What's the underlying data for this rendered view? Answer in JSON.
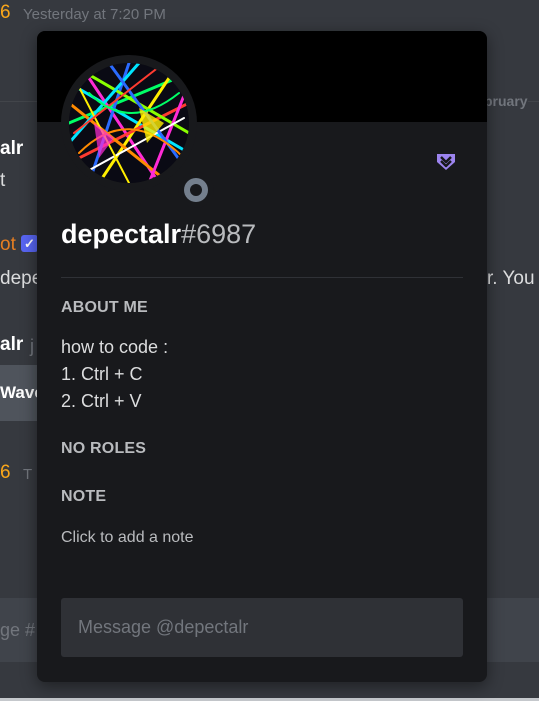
{
  "background": {
    "top_fragment": "6",
    "top_timestamp": "Yesterday at 7:20 PM",
    "date_divider_fragment": "bruary",
    "author_fragment": "alr",
    "text_fragment": "t",
    "bot_fragment": "ot",
    "bot_check": "✓",
    "message_left_fragment": "depe",
    "message_right_fragment": "r. You",
    "author2_fragment": "alr",
    "author2_tail": "j",
    "embed_fragment": "Wave",
    "third_num_fragment": "6",
    "third_tail": "T",
    "input_fragment": "ge #"
  },
  "popout": {
    "username": "depectalr",
    "discriminator": "#6987",
    "about_title": "ABOUT ME",
    "about_lines": [
      "how to code :",
      "1. Ctrl + C",
      "2. Ctrl + V"
    ],
    "roles_title": "NO ROLES",
    "note_title": "NOTE",
    "note_placeholder": "Click to add a note",
    "message_placeholder": "Message @depectalr",
    "status": "offline",
    "badge_icon": "hypesquad-icon"
  },
  "colors": {
    "accent": "#5865f2",
    "badge": "#9c84ef",
    "status_offline": "#747f8d"
  }
}
